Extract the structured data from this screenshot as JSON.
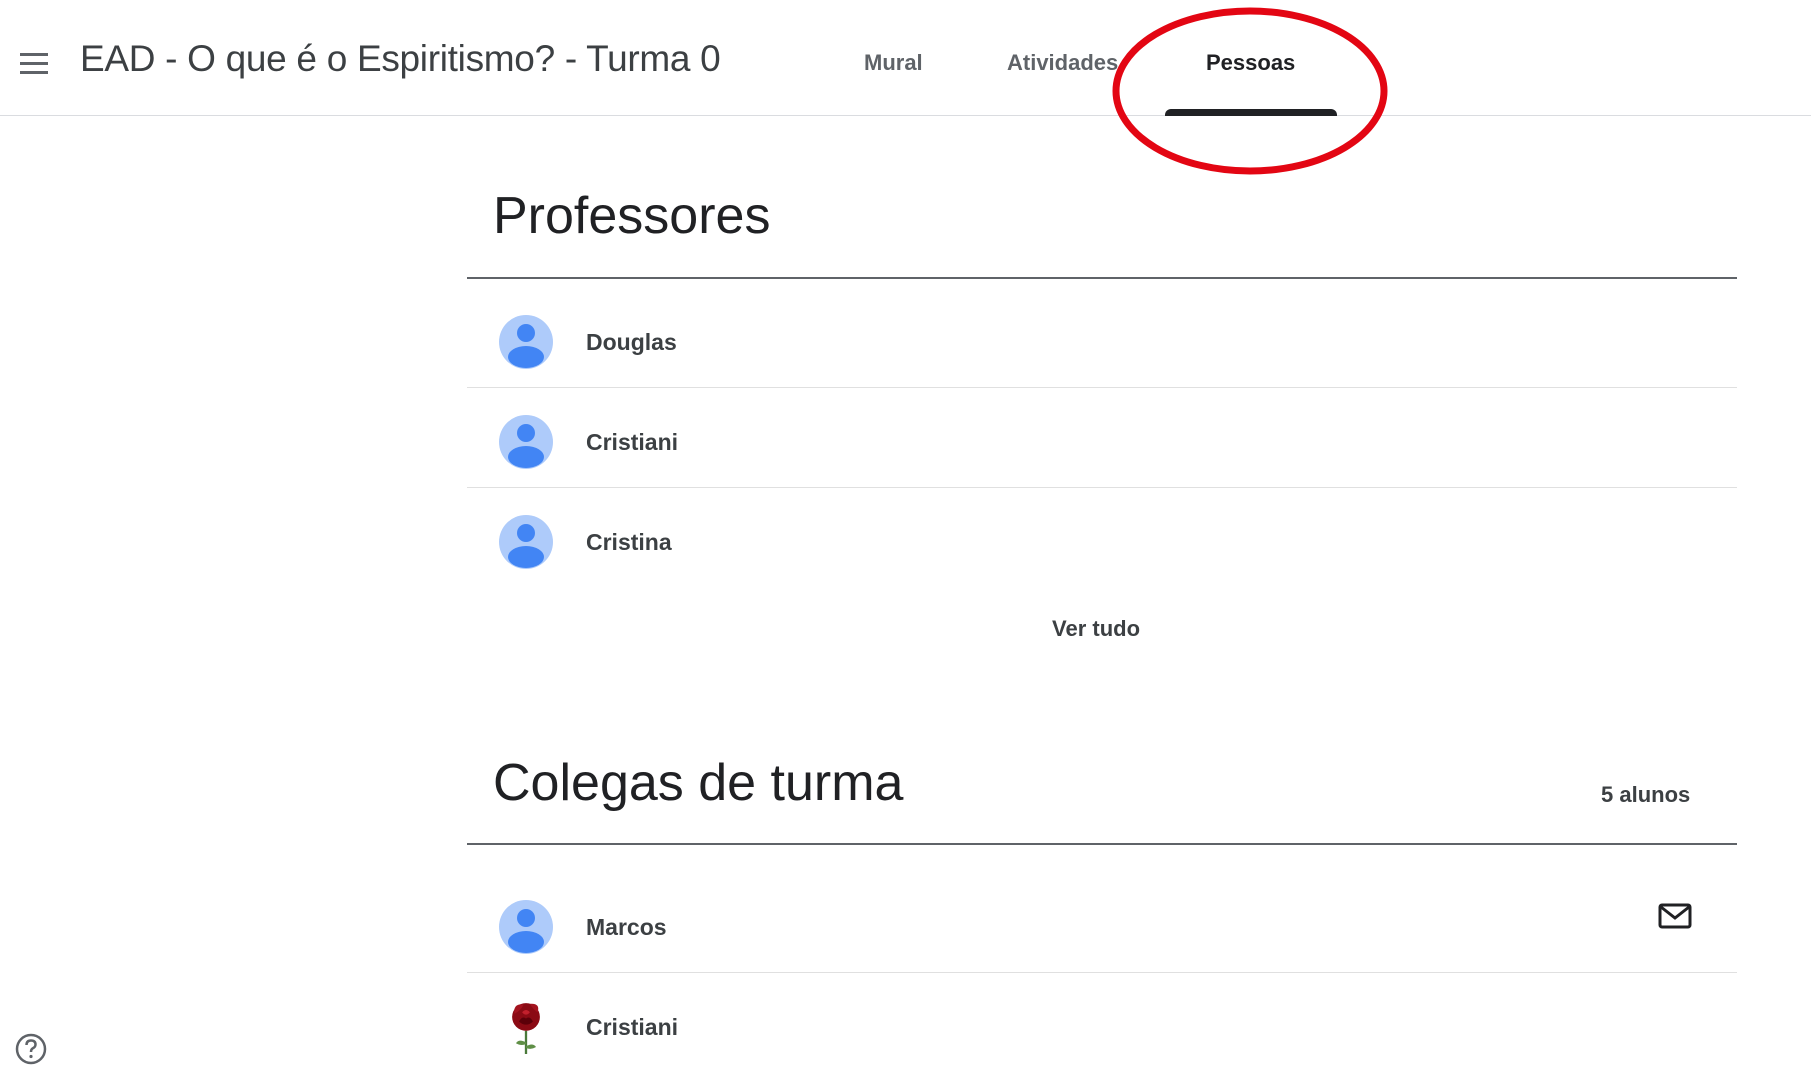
{
  "header": {
    "course_title": "EAD - O que é o Espiritismo? - Turma 0",
    "menu_icon": "hamburger-menu-icon",
    "tabs": [
      {
        "label": "Mural"
      },
      {
        "label": "Atividades"
      },
      {
        "label": "Pessoas",
        "active": true
      }
    ]
  },
  "annotation": {
    "color": "#e30613"
  },
  "teachers": {
    "title": "Professores",
    "people": [
      {
        "name": "Douglas"
      },
      {
        "name": "Cristiani"
      },
      {
        "name": "Cristina"
      }
    ],
    "see_all_label": "Ver tudo"
  },
  "classmates": {
    "title": "Colegas de turma",
    "count_label": "5 alunos",
    "people": [
      {
        "name": "Marcos"
      },
      {
        "name": "Cristiani"
      }
    ],
    "mail_icon": "email-icon"
  },
  "footer": {
    "help_icon": "help-icon"
  },
  "colors": {
    "avatar_bg": "#aecbfa",
    "avatar_fg": "#4285f4"
  }
}
